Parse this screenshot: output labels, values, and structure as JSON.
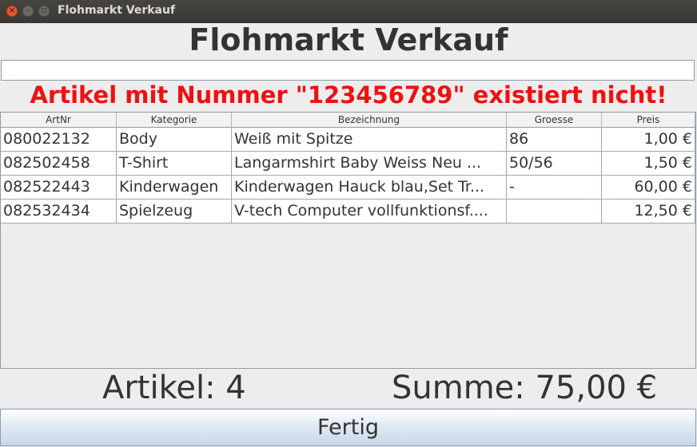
{
  "window": {
    "title": "Flohmarkt Verkauf",
    "close_glyph": "×",
    "min_glyph": "–",
    "max_glyph": "▫"
  },
  "heading": "Flohmarkt Verkauf",
  "scan_input": {
    "value": "",
    "placeholder": ""
  },
  "error_message": "Artikel mit Nummer \"123456789\" existiert nicht!",
  "table": {
    "columns": [
      "ArtNr",
      "Kategorie",
      "Bezeichnung",
      "Groesse",
      "Preis"
    ],
    "rows": [
      [
        "080022132",
        "Body",
        "Weiß mit Spitze",
        "86",
        "1,00 €"
      ],
      [
        "082502458",
        "T-Shirt",
        "Langarmshirt Baby Weiss Neu ...",
        "50/56",
        "1,50 €"
      ],
      [
        "082522443",
        "Kinderwagen",
        "Kinderwagen Hauck blau,Set Tr...",
        "-",
        "60,00 €"
      ],
      [
        "082532434",
        "Spielzeug",
        "V-tech Computer vollfunktionsf....",
        "",
        "12,50 €"
      ]
    ]
  },
  "summary": {
    "count": "Artikel: 4",
    "sum": "Summe: 75,00 €"
  },
  "done_button": "Fertig",
  "colors": {
    "error": "#ee1111",
    "titlebar": "#3c3b37",
    "close_button": "#e9562d"
  }
}
